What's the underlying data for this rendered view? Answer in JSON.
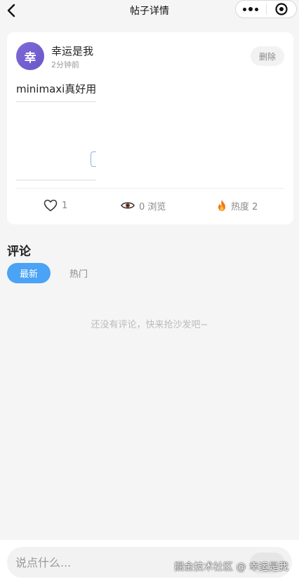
{
  "navbar": {
    "title": "帖子详情",
    "back_icon": "chevron-left-icon",
    "more_icon": "more-dots-icon",
    "close_icon": "target-circle-icon"
  },
  "post": {
    "author_initial": "幸",
    "author_name": "幸运是我",
    "time": "2分钟前",
    "delete_label": "删除",
    "content": "minimaxi真好用",
    "stats": {
      "likes": "1",
      "views": "0 浏览",
      "heat": "热度 2"
    }
  },
  "comments": {
    "title": "评论",
    "tabs": [
      {
        "label": "最新",
        "active": true
      },
      {
        "label": "热门",
        "active": false
      }
    ],
    "empty_text": "还没有评论，快来抢沙发吧~"
  },
  "composer": {
    "placeholder": "说点什么..."
  },
  "watermark": "掘金技术社区 @ 幸运是我",
  "colors": {
    "accent": "#4aa3f5",
    "avatar": "#6f5bd0",
    "background": "#f5f5f6"
  }
}
